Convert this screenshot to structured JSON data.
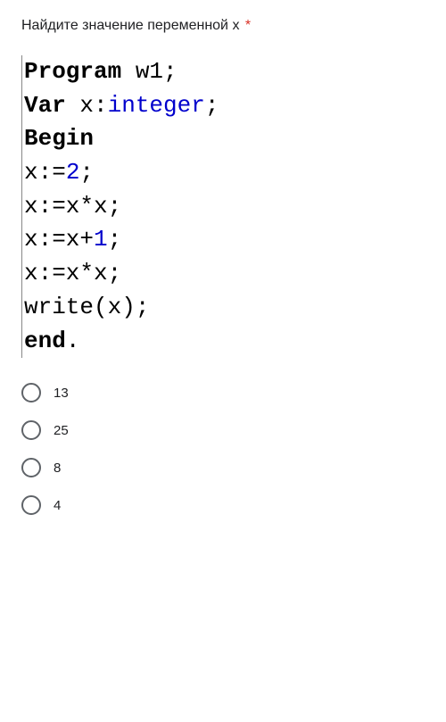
{
  "question": {
    "title": "Найдите значение переменной x",
    "required_marker": "*"
  },
  "code": {
    "line1_kw": "Program",
    "line1_rest": " w1;",
    "line2_kw": "Var",
    "line2_mid": " x:",
    "line2_type": "integer",
    "line2_end": ";",
    "line3_kw": "Begin",
    "line4_a": "x:=",
    "line4_num": "2",
    "line4_b": ";",
    "line5": "x:=x*x;",
    "line6_a": "x:=x+",
    "line6_num": "1",
    "line6_b": ";",
    "line7": "x:=x*x;",
    "line8": "write(x);",
    "line9_kw": "end",
    "line9_b": "."
  },
  "options": [
    {
      "label": "13"
    },
    {
      "label": "25"
    },
    {
      "label": "8"
    },
    {
      "label": "4"
    }
  ]
}
